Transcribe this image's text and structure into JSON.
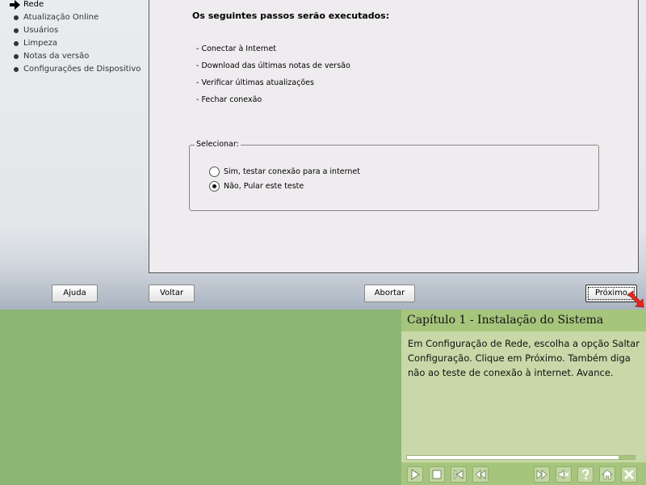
{
  "sidebar": {
    "items": [
      {
        "label": "Rede",
        "current": true
      },
      {
        "label": "Atualização Online",
        "current": false
      },
      {
        "label": "Usuários",
        "current": false
      },
      {
        "label": "Limpeza",
        "current": false
      },
      {
        "label": "Notas da versão",
        "current": false
      },
      {
        "label": "Configurações de Dispositivo",
        "current": false
      }
    ]
  },
  "content": {
    "heading": "Os seguintes passos serão executados:",
    "steps": [
      "- Conectar à Internet",
      "- Download das últimas notas de versão",
      "- Verificar últimas atualizações",
      "- Fechar conexão"
    ],
    "select_group": {
      "legend": "Selecionar:",
      "options": [
        {
          "label": "Sim, testar conexão para a internet",
          "checked": false
        },
        {
          "label": "Não, Pular este teste",
          "checked": true
        }
      ]
    }
  },
  "buttons": {
    "help": "Ajuda",
    "back": "Voltar",
    "abort": "Abortar",
    "next": "Próximo"
  },
  "tutorial": {
    "title": "Capítulo 1 - Instalação do Sistema",
    "body": "Em Configuração de Rede, escolha a opção Saltar Configuração. Clique em Próximo. Também diga não ao teste de conexão à internet. Avance.",
    "progress_fraction": 0.93,
    "controls": [
      "play-icon",
      "stop-icon",
      "skip-back-icon",
      "rewind-icon",
      "fast-forward-icon",
      "mute-icon",
      "help-icon",
      "home-icon",
      "close-icon"
    ]
  },
  "colors": {
    "accent_pointer": "#e8281e",
    "desktop_green": "#8db573",
    "tutorial_header": "#a6c57c"
  }
}
